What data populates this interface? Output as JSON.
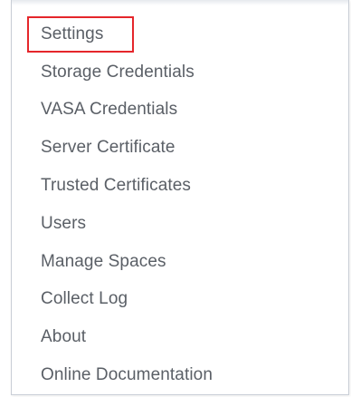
{
  "menu": {
    "items": [
      {
        "id": "settings",
        "label": "Settings",
        "highlighted": true
      },
      {
        "id": "storage-credentials",
        "label": "Storage Credentials"
      },
      {
        "id": "vasa-credentials",
        "label": "VASA Credentials"
      },
      {
        "id": "server-certificate",
        "label": "Server Certificate"
      },
      {
        "id": "trusted-certificates",
        "label": "Trusted Certificates"
      },
      {
        "id": "users",
        "label": "Users"
      },
      {
        "id": "manage-spaces",
        "label": "Manage Spaces"
      },
      {
        "id": "collect-log",
        "label": "Collect Log"
      },
      {
        "id": "about",
        "label": "About"
      },
      {
        "id": "online-documentation",
        "label": "Online Documentation"
      }
    ]
  },
  "colors": {
    "text": "#5a5f66",
    "highlight_border": "#e5262b",
    "panel_border": "#c9ced6"
  }
}
